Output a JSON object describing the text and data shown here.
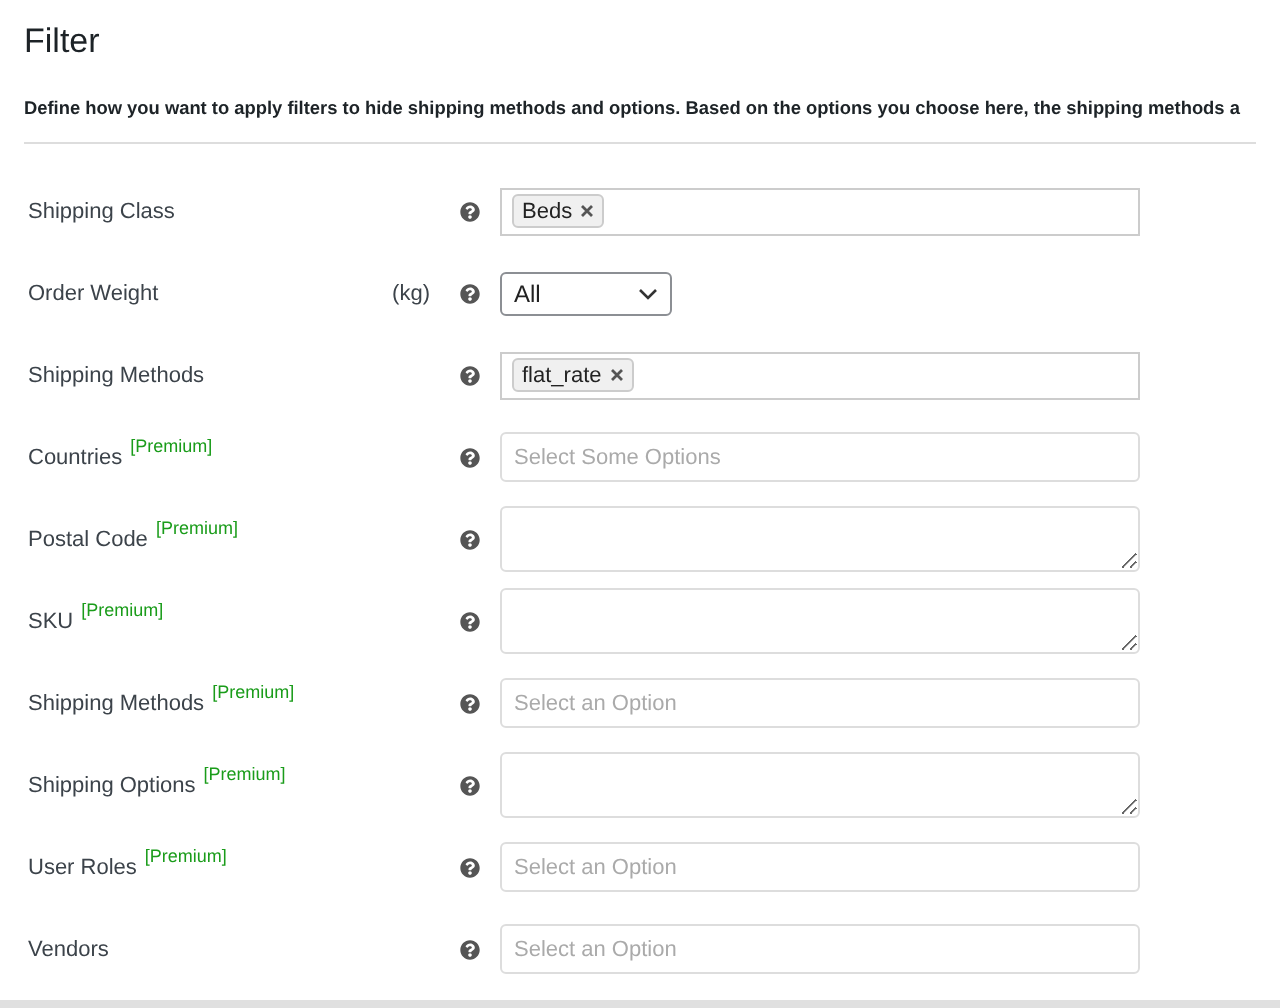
{
  "title": "Filter",
  "description": "Define how you want to apply filters to hide shipping methods and options. Based on the options you choose here, the shipping methods a",
  "rows": [
    {
      "label": "Shipping Class",
      "kind": "tags",
      "tags": [
        "Beds"
      ]
    },
    {
      "label": "Order Weight",
      "unit": "(kg)",
      "kind": "select",
      "value": "All"
    },
    {
      "label": "Shipping Methods",
      "kind": "tags",
      "tags": [
        "flat_rate"
      ]
    },
    {
      "label": "Countries",
      "badge": "[Premium]",
      "kind": "input",
      "placeholder": "Select Some Options"
    },
    {
      "label": "Postal Code",
      "badge": "[Premium]",
      "kind": "textarea"
    },
    {
      "label": "SKU",
      "badge": "[Premium]",
      "kind": "textarea"
    },
    {
      "label": "Shipping Methods",
      "badge": "[Premium]",
      "kind": "input",
      "placeholder": "Select an Option"
    },
    {
      "label": "Shipping Options",
      "badge": "[Premium]",
      "kind": "textarea"
    },
    {
      "label": "User Roles",
      "badge": "[Premium]",
      "kind": "input",
      "placeholder": "Select an Option"
    },
    {
      "label": "Vendors",
      "kind": "input",
      "placeholder": "Select an Option"
    }
  ]
}
